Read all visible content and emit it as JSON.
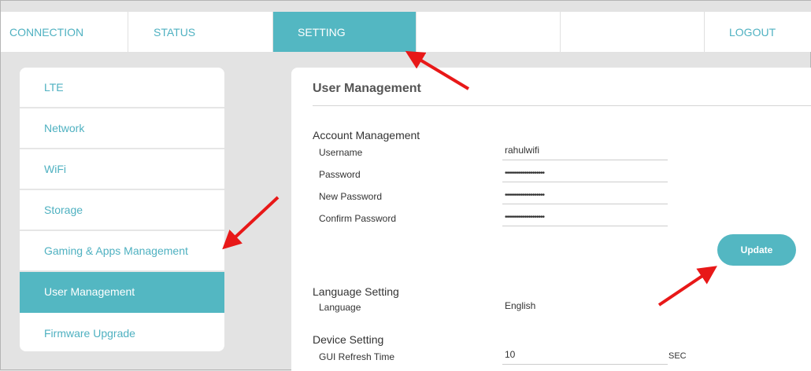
{
  "topnav": {
    "tabs": [
      {
        "label": "CONNECTION"
      },
      {
        "label": "STATUS"
      },
      {
        "label": "SETTING"
      },
      {
        "label": ""
      },
      {
        "label": ""
      },
      {
        "label": "LOGOUT"
      }
    ],
    "active_index": 2
  },
  "sidebar": {
    "items": [
      {
        "label": "LTE"
      },
      {
        "label": "Network"
      },
      {
        "label": "WiFi"
      },
      {
        "label": "Storage"
      },
      {
        "label": "Gaming & Apps Management"
      },
      {
        "label": "User Management"
      },
      {
        "label": "Firmware Upgrade"
      }
    ],
    "active_index": 5
  },
  "main": {
    "title": "User Management",
    "account": {
      "heading": "Account Management",
      "username_label": "Username",
      "username_value": "rahulwifi",
      "password_label": "Password",
      "password_value": "••••••••••••••••••••",
      "new_password_label": "New Password",
      "new_password_value": "••••••••••••••••••••",
      "confirm_password_label": "Confirm Password",
      "confirm_password_value": "••••••••••••••••••••",
      "update_label": "Update"
    },
    "language": {
      "heading": "Language Setting",
      "label": "Language",
      "value": "English"
    },
    "device": {
      "heading": "Device Setting",
      "refresh_label": "GUI Refresh Time",
      "refresh_value": "10",
      "refresh_unit": "SEC"
    }
  },
  "colors": {
    "accent": "#53b7c2",
    "link": "#4fb1c1",
    "annotation_arrow": "#e81818"
  }
}
